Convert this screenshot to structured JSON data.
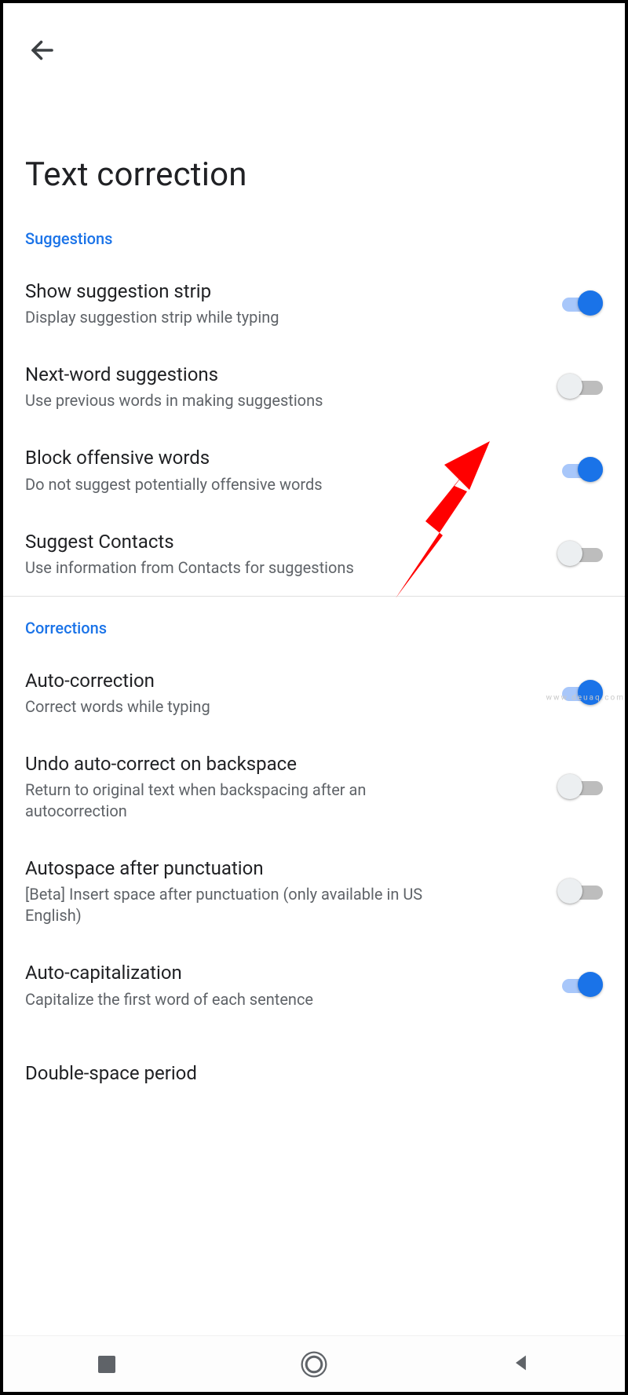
{
  "page": {
    "title": "Text correction"
  },
  "sections": {
    "suggestions": {
      "header": "Suggestions",
      "items": {
        "show_strip": {
          "title": "Show suggestion strip",
          "sub": "Display suggestion strip while typing",
          "on": true
        },
        "next_word": {
          "title": "Next-word suggestions",
          "sub": "Use previous words in making suggestions",
          "on": false
        },
        "block_offensive": {
          "title": "Block offensive words",
          "sub": "Do not suggest potentially offensive words",
          "on": true
        },
        "suggest_contacts": {
          "title": "Suggest Contacts",
          "sub": "Use information from Contacts for suggestions",
          "on": false
        }
      }
    },
    "corrections": {
      "header": "Corrections",
      "items": {
        "auto_correction": {
          "title": "Auto-correction",
          "sub": "Correct words while typing",
          "on": true
        },
        "undo_backspace": {
          "title": "Undo auto-correct on backspace",
          "sub": "Return to original text when backspacing after an autocorrection",
          "on": false
        },
        "autospace_punct": {
          "title": "Autospace after punctuation",
          "sub": "[Beta] Insert space after punctuation (only available in US English)",
          "on": false
        },
        "auto_cap": {
          "title": "Auto-capitalization",
          "sub": "Capitalize the first word of each sentence",
          "on": true
        },
        "double_space": {
          "title": "Double-space period",
          "sub": "",
          "on": true
        }
      }
    }
  },
  "watermark": "www.deuaq.com",
  "annotation": {
    "arrow_color": "#ff0000",
    "points_to": "next_word_toggle"
  }
}
